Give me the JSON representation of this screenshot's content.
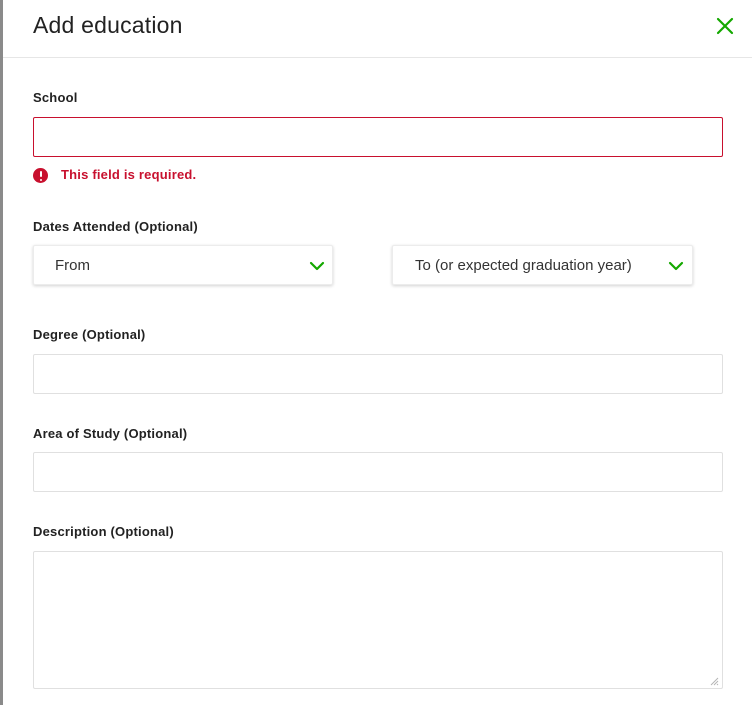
{
  "dialog": {
    "title": "Add education",
    "close_icon": "close-icon"
  },
  "fields": {
    "school": {
      "label": "School",
      "value": "",
      "error": "This field is required."
    },
    "dates": {
      "label": "Dates Attended (Optional)",
      "from_selected": "From",
      "to_selected": "To (or expected graduation year)"
    },
    "degree": {
      "label": "Degree (Optional)",
      "value": ""
    },
    "area_of_study": {
      "label": "Area of Study (Optional)",
      "value": ""
    },
    "description": {
      "label": "Description (Optional)",
      "value": ""
    }
  },
  "colors": {
    "accent_green": "#14a800",
    "error_red": "#c8102e",
    "text": "#222222",
    "border": "#e0e0e0"
  }
}
